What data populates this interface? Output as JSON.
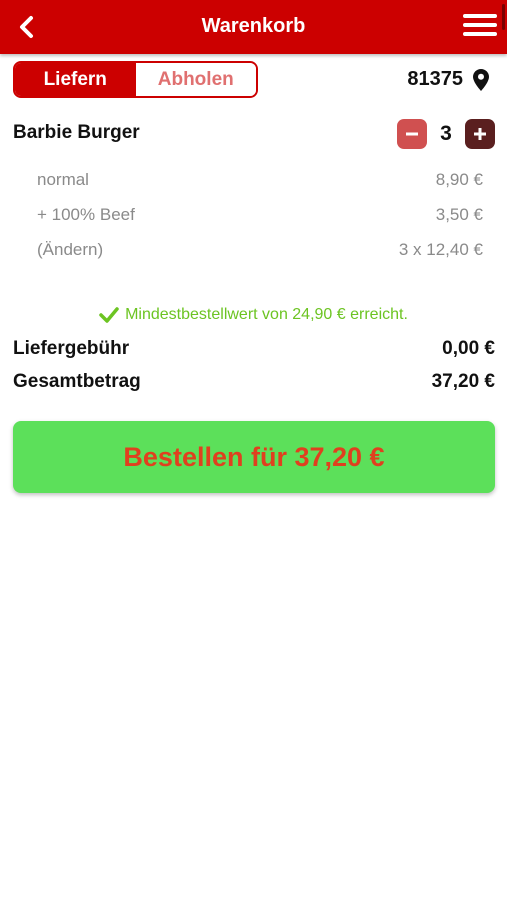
{
  "header": {
    "title": "Warenkorb",
    "back_icon": "chevron-left-icon",
    "menu_icon": "hamburger-menu-icon",
    "background_color": "#cc0000"
  },
  "tabs": [
    {
      "label": "Liefern",
      "active": true
    },
    {
      "label": "Abholen",
      "active": false
    }
  ],
  "location": {
    "zip": "81375",
    "icon": "map-pin-icon"
  },
  "cart": {
    "item": {
      "name": "Barbie Burger",
      "quantity": "3",
      "details": [
        {
          "label": "normal",
          "value": "8,90 €"
        },
        {
          "label": "+ 100% Beef",
          "value": "3,50 €"
        },
        {
          "label": "(Ändern)",
          "value": "3 x 12,40 €"
        }
      ]
    }
  },
  "notice": {
    "text": "Mindestbestellwert von 24,90 € erreicht.",
    "icon": "check-icon",
    "color": "#6cc422"
  },
  "summary": {
    "delivery_fee_label": "Liefergebühr",
    "delivery_fee_value": "0,00 €",
    "total_label": "Gesamtbetrag",
    "total_value": "37,20 €"
  },
  "order_button": {
    "label": "Bestellen für 37,20 €",
    "background_color": "#5ce05a",
    "text_color": "#e0401f"
  }
}
